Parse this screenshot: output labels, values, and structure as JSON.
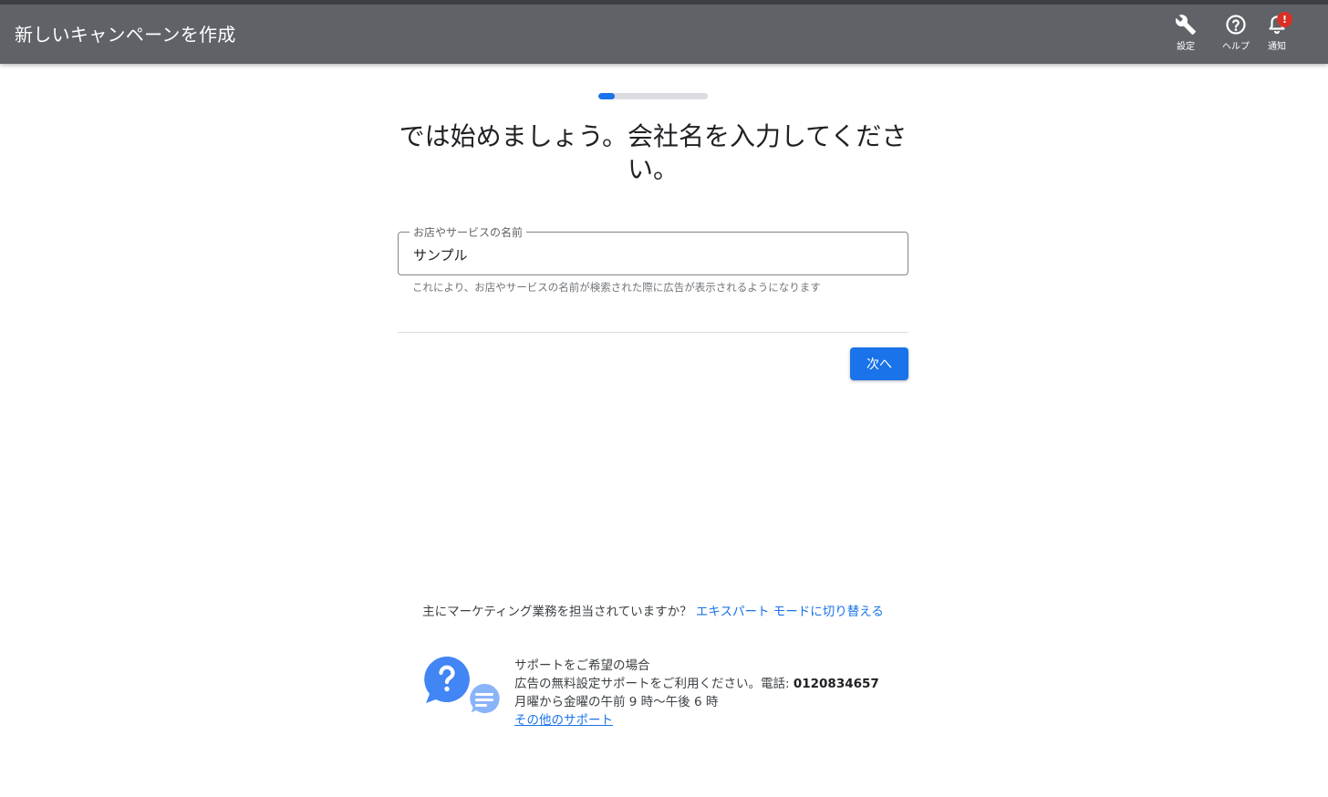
{
  "header": {
    "title": "新しいキャンペーンを作成",
    "actions": {
      "settings_label": "設定",
      "help_label": "ヘルプ",
      "notifications_label": "通知",
      "notifications_badge": "!"
    }
  },
  "progress": {
    "fraction": 0.15
  },
  "main": {
    "heading": "では始めましょう。会社名を入力してください。",
    "business_name": {
      "label": "お店やサービスの名前",
      "value": "サンプル",
      "hint": "これにより、お店やサービスの名前が検索された際に広告が表示されるようになります"
    },
    "next_label": "次へ"
  },
  "footer": {
    "expert_question": "主にマーケティング業務を担当されていますか？",
    "expert_link": "エキスパート モードに切り替える",
    "support": {
      "title": "サポートをご希望の場合",
      "line_prefix": "広告の無料設定サポートをご利用ください。電話:",
      "phone": "0120834657",
      "hours": "月曜から金曜の午前 9 時～午後 6 時",
      "more_link": "その他のサポート"
    }
  },
  "colors": {
    "header_bg": "#5f6368",
    "accent": "#1a73e8",
    "badge": "#d93025"
  }
}
